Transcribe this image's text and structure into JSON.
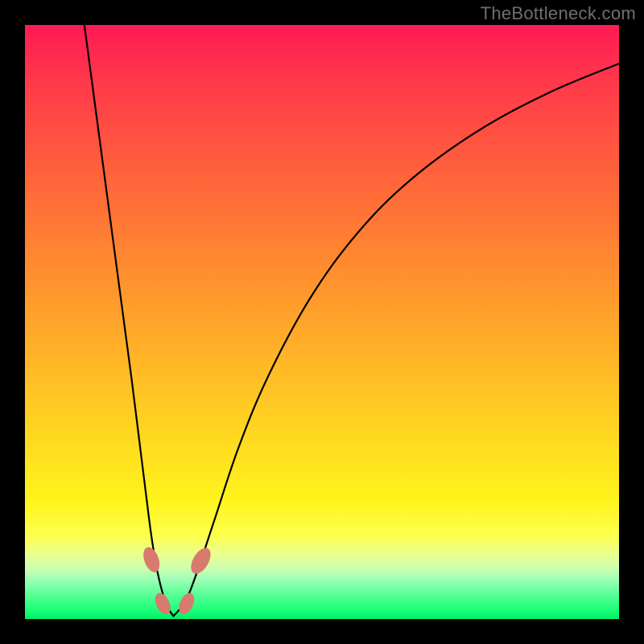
{
  "watermark": "TheBottleneck.com",
  "colors": {
    "frame_bg": "#000000",
    "watermark_text": "#6f6f6f",
    "curve_stroke": "#000000",
    "bead_fill": "#d87a6e",
    "gradient_top": "#ff1a55",
    "gradient_bottom": "#00ef68"
  },
  "chart_data": {
    "type": "line",
    "title": "",
    "xlabel": "",
    "ylabel": "",
    "xlim": [
      0,
      100
    ],
    "ylim": [
      0,
      100
    ],
    "annotations": [
      "TheBottleneck.com"
    ],
    "note": "Axes are unlabeled; values are normalized 0–100 positions read from the image. y=0 at bottom (green), y=100 at top (red). The two curves form a V shape with minimum near x≈25, y≈0.",
    "series": [
      {
        "name": "left-curve",
        "x": [
          10.0,
          12.0,
          14.0,
          16.0,
          18.0,
          19.5,
          21.0,
          22.0,
          23.0,
          24.0,
          25.0
        ],
        "values": [
          100.0,
          85.0,
          70.0,
          55.0,
          40.0,
          28.0,
          16.0,
          9.5,
          5.0,
          2.0,
          0.5
        ]
      },
      {
        "name": "right-curve",
        "x": [
          25.0,
          27.0,
          29.0,
          32.0,
          36.0,
          41.0,
          48.0,
          56.0,
          65.0,
          76.0,
          88.0,
          100.0
        ],
        "values": [
          0.5,
          3.0,
          8.0,
          17.0,
          29.0,
          41.0,
          54.0,
          65.0,
          74.0,
          82.0,
          88.5,
          93.5
        ]
      }
    ],
    "markers": [
      {
        "name": "bead-left-upper",
        "x": 21.3,
        "y": 10.0,
        "rx": 1.2,
        "ry": 2.2,
        "rotation": -20
      },
      {
        "name": "bead-left-lower",
        "x": 23.2,
        "y": 2.6,
        "rx": 1.1,
        "ry": 1.9,
        "rotation": -25
      },
      {
        "name": "bead-right-lower",
        "x": 27.2,
        "y": 2.6,
        "rx": 1.1,
        "ry": 1.9,
        "rotation": 25
      },
      {
        "name": "bead-right-upper",
        "x": 29.6,
        "y": 9.8,
        "rx": 1.3,
        "ry": 2.4,
        "rotation": 30
      }
    ]
  }
}
